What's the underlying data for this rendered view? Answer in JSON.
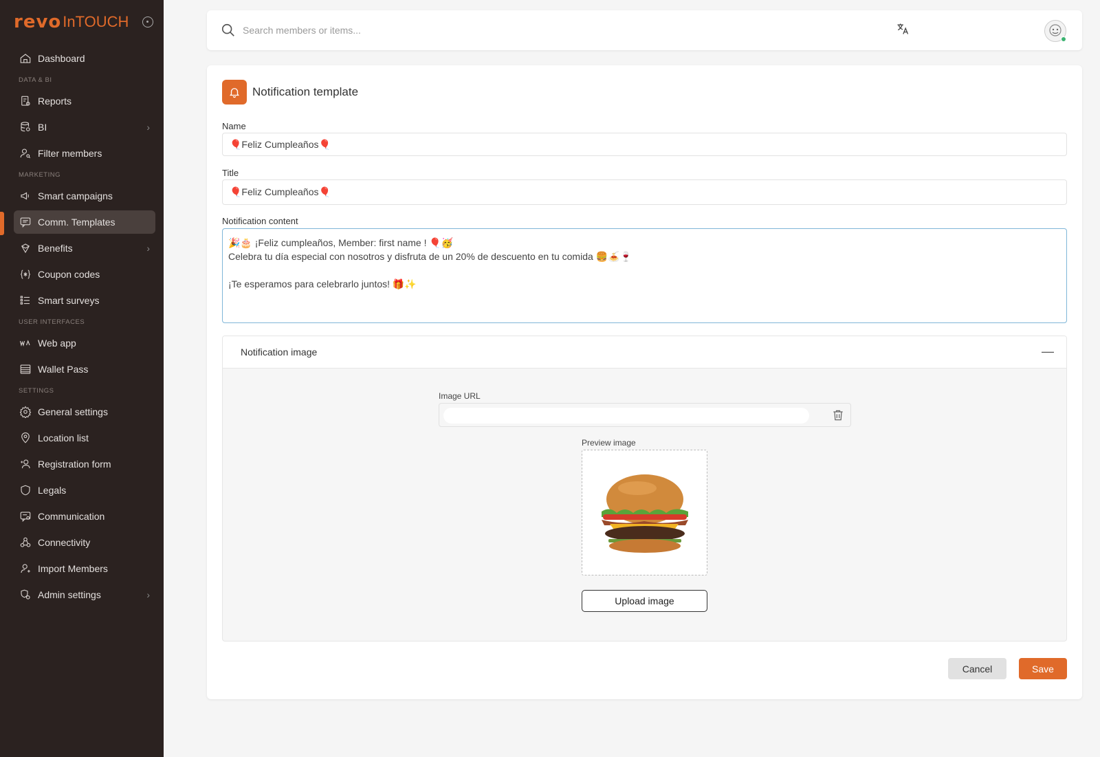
{
  "app": {
    "logo_revo": "revo",
    "logo_touch": "InTOUCH",
    "accent": "#e06a2a"
  },
  "sidebar": {
    "items": [
      {
        "label": "Dashboard",
        "icon": "home-icon"
      },
      {
        "section": "DATA & BI"
      },
      {
        "label": "Reports",
        "icon": "reports-icon"
      },
      {
        "label": "BI",
        "icon": "database-icon",
        "chevron": true
      },
      {
        "label": "Filter members",
        "icon": "user-search-icon"
      },
      {
        "section": "MARKETING"
      },
      {
        "label": "Smart campaigns",
        "icon": "megaphone-icon"
      },
      {
        "label": "Comm. Templates",
        "icon": "message-icon",
        "active": true
      },
      {
        "label": "Benefits",
        "icon": "gift-icon",
        "chevron": true
      },
      {
        "label": "Coupon codes",
        "icon": "coupon-icon"
      },
      {
        "label": "Smart surveys",
        "icon": "list-icon"
      },
      {
        "section": "USER INTERFACES"
      },
      {
        "label": "Web app",
        "icon": "pwa-icon"
      },
      {
        "label": "Wallet Pass",
        "icon": "wallet-icon"
      },
      {
        "section": "SETTINGS"
      },
      {
        "label": "General settings",
        "icon": "gear-icon"
      },
      {
        "label": "Location list",
        "icon": "pin-icon"
      },
      {
        "label": "Registration form",
        "icon": "user-plus-icon"
      },
      {
        "label": "Legals",
        "icon": "shield-icon"
      },
      {
        "label": "Communication",
        "icon": "chat-icon"
      },
      {
        "label": "Connectivity",
        "icon": "connectivity-icon"
      },
      {
        "label": "Import Members",
        "icon": "user-import-icon"
      },
      {
        "label": "Admin settings",
        "icon": "admin-icon",
        "chevron": true
      }
    ]
  },
  "topbar": {
    "search_placeholder": "Search members or items..."
  },
  "page": {
    "title": "Notification template",
    "name_label": "Name",
    "name_value": "🎈Feliz Cumpleaños🎈",
    "title_label": "Title",
    "title_value": "🎈Feliz Cumpleaños🎈",
    "content_label": "Notification content",
    "content_value": "🎉🎂 ¡Feliz cumpleaños, Member: first name ! 🎈🥳\nCelebra tu día especial con nosotros y disfruta de un 20% de descuento en tu comida 🍔🍝🍷\n\n¡Te esperamos para celebrarlo juntos! 🎁✨",
    "image_section_title": "Notification image",
    "image_url_label": "Image URL",
    "image_url_value": "",
    "preview_label": "Preview image",
    "upload_label": "Upload image",
    "cancel_label": "Cancel",
    "save_label": "Save"
  }
}
